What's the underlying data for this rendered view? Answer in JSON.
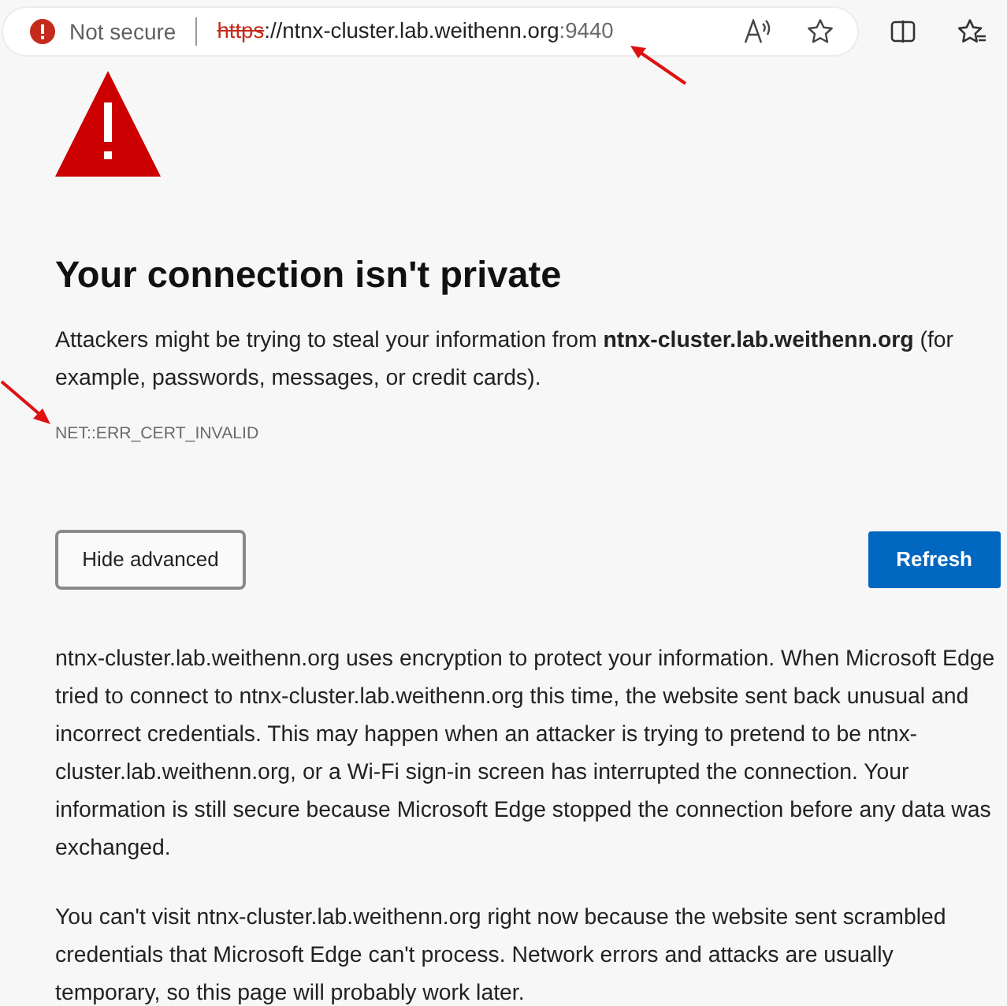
{
  "address_bar": {
    "security_label": "Not secure",
    "url_scheme": "https",
    "scheme_crossed_out": true,
    "url_host": "://ntnx-cluster.lab.weithenn.org",
    "url_port": ":9440"
  },
  "page": {
    "title": "Your connection isn't private",
    "message": "Attackers might be trying to steal your information from **ntnx-cluster.lab.weithenn.org** (for example, passwords, messages, or credit cards).",
    "error_code": "NET::ERR_CERT_INVALID",
    "buttons": [
      {
        "label": "Hide advanced",
        "kind": "secondary"
      },
      {
        "label": "Refresh",
        "kind": "primary"
      }
    ],
    "details": [
      "ntnx-cluster.lab.weithenn.org uses encryption to protect your information. When Microsoft Edge tried to connect to ntnx-cluster.lab.weithenn.org this time, the website sent back unusual and incorrect credentials. This may happen when an attacker is trying to pretend to be ntnx-cluster.lab.weithenn.org, or a Wi-Fi sign-in screen has interrupted the connection. Your information is still secure because Microsoft Edge stopped the connection before any data was exchanged.",
      "You can't visit ntnx-cluster.lab.weithenn.org right now because the website sent scrambled credentials that Microsoft Edge can't process. Network errors and attacks are usually temporary, so this page will probably work later."
    ]
  }
}
